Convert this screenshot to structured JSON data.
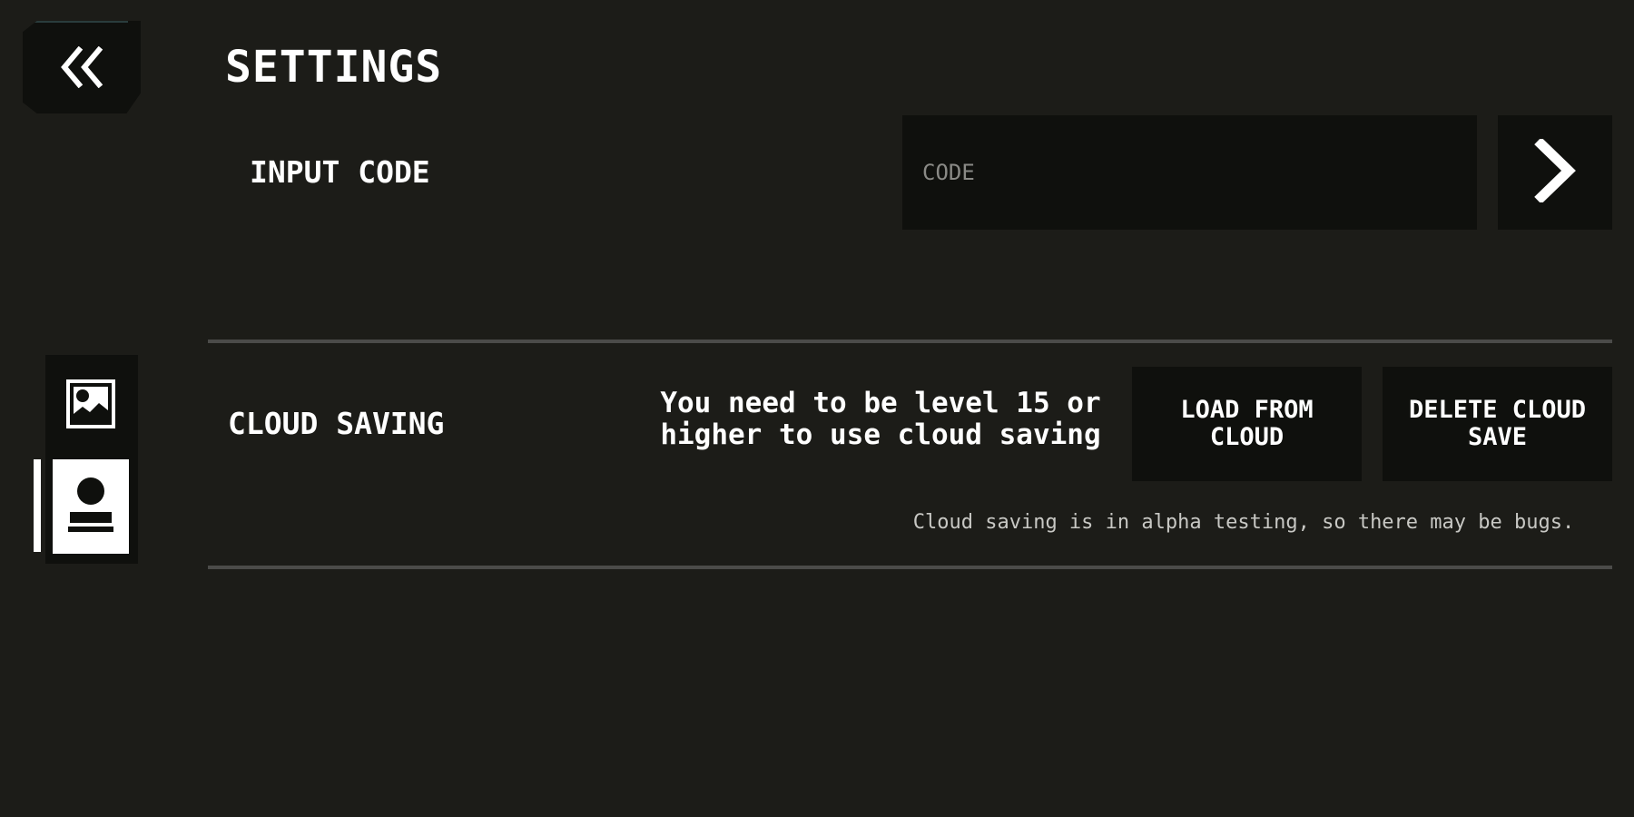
{
  "header": {
    "title": "SETTINGS",
    "back_icon": "double-chevron-left-icon"
  },
  "side_tabs": [
    {
      "icon": "image-icon",
      "active": false
    },
    {
      "icon": "user-icon",
      "active": true
    }
  ],
  "input_code": {
    "label": "INPUT CODE",
    "placeholder": "CODE",
    "value": "",
    "submit_icon": "chevron-right-icon"
  },
  "cloud_saving": {
    "label": "CLOUD SAVING",
    "level_message": "You need to be level 15 or higher to use cloud saving",
    "load_button": "LOAD FROM CLOUD",
    "delete_button": "DELETE CLOUD SAVE",
    "note": "Cloud saving is in alpha testing, so there may be bugs."
  },
  "colors": {
    "background": "#1c1c18",
    "panel": "#0f100d",
    "divider": "#4b4b49",
    "text": "#ffffff",
    "muted_text": "#c8c8c4"
  }
}
